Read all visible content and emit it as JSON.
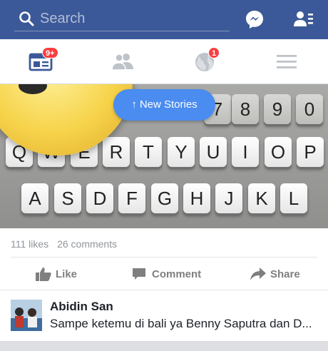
{
  "header": {
    "search_placeholder": "Search",
    "icons": [
      "search-icon",
      "messenger-icon",
      "friend-requests-icon"
    ]
  },
  "tabs": [
    {
      "name": "news-feed",
      "icon": "news-feed-icon",
      "badge": "9+",
      "active": true
    },
    {
      "name": "friends",
      "icon": "friends-icon",
      "badge": "",
      "active": false
    },
    {
      "name": "notifications",
      "icon": "globe-icon",
      "badge": "1",
      "active": false
    },
    {
      "name": "menu",
      "icon": "menu-icon",
      "badge": "",
      "active": false
    }
  ],
  "photo": {
    "new_stories_label": "New Stories",
    "keys_row1": [
      "7",
      "8",
      "9",
      "0"
    ],
    "keys_row2": [
      "Q",
      "W",
      "E",
      "R",
      "T",
      "Y",
      "U",
      "I",
      "O",
      "P"
    ],
    "keys_row3": [
      "A",
      "S",
      "D",
      "F",
      "G",
      "H",
      "J",
      "K",
      "L"
    ]
  },
  "post": {
    "likes": "111 likes",
    "comments": "26 comments",
    "actions": {
      "like": "Like",
      "comment": "Comment",
      "share": "Share"
    }
  },
  "comment_preview": {
    "author": "Abidin San",
    "text": "Sampe ketemu di bali ya Benny Saputra dan D..."
  },
  "colors": {
    "brand": "#3b5998",
    "badge": "#fa3e3e",
    "new_stories": "#4a8cf0",
    "action_text": "#7f7f7f"
  }
}
